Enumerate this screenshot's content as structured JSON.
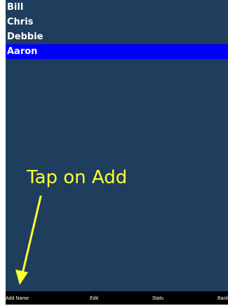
{
  "names": [
    {
      "label": "Bill",
      "selected": false
    },
    {
      "label": "Chris",
      "selected": false
    },
    {
      "label": "Debbie",
      "selected": false
    },
    {
      "label": "Aaron",
      "selected": true
    }
  ],
  "annotation": {
    "text": "Tap on Add",
    "color": "#ffff33"
  },
  "toolbar": {
    "add_name_label": "Add Name",
    "edit_label": "Edit",
    "stats_label": "Stats",
    "back_label": "Back"
  },
  "colors": {
    "background": "#1f3d5c",
    "selected_row": "#0000ff",
    "toolbar": "#000000"
  }
}
